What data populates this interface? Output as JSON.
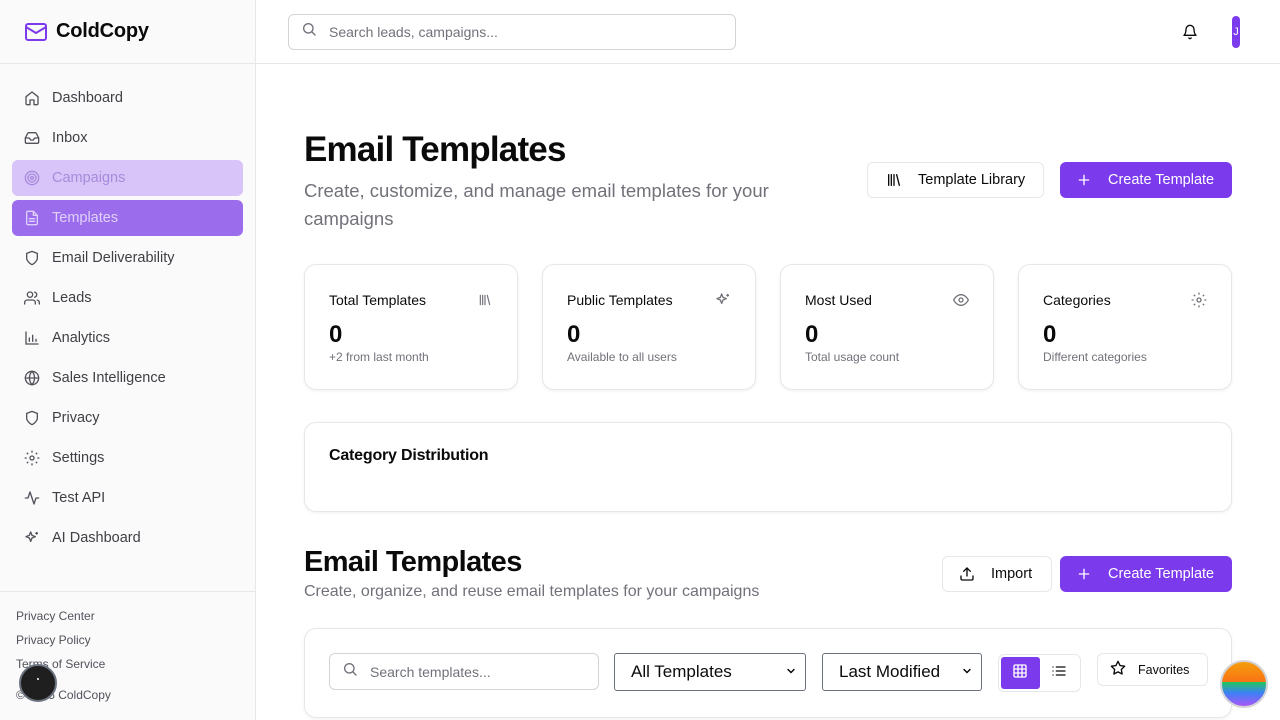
{
  "brand": {
    "name": "ColdCopy",
    "icon": "mail-icon",
    "accent": "#7c3aed"
  },
  "sidebar": {
    "items": [
      {
        "label": "Dashboard",
        "icon": "home-icon",
        "state": "normal"
      },
      {
        "label": "Inbox",
        "icon": "inbox-icon",
        "state": "normal"
      },
      {
        "label": "Campaigns",
        "icon": "target-icon",
        "state": "hover"
      },
      {
        "label": "Templates",
        "icon": "file-text-icon",
        "state": "active"
      },
      {
        "label": "Email Deliverability",
        "icon": "shield-icon",
        "state": "normal"
      },
      {
        "label": "Leads",
        "icon": "users-icon",
        "state": "normal"
      },
      {
        "label": "Analytics",
        "icon": "bar-chart-icon",
        "state": "normal"
      },
      {
        "label": "Sales Intelligence",
        "icon": "brain-icon",
        "state": "normal"
      },
      {
        "label": "Privacy",
        "icon": "shield-icon",
        "state": "normal"
      },
      {
        "label": "Settings",
        "icon": "gear-icon",
        "state": "normal"
      },
      {
        "label": "Test API",
        "icon": "activity-icon",
        "state": "normal"
      },
      {
        "label": "AI Dashboard",
        "icon": "sparkles-icon",
        "state": "normal"
      }
    ],
    "footer": {
      "links": [
        "Privacy Center",
        "Privacy Policy",
        "Terms of Service"
      ],
      "copyright": "© 2025 ColdCopy"
    }
  },
  "header": {
    "search_placeholder": "Search leads, campaigns...",
    "avatar_initial": "J"
  },
  "page": {
    "title": "Email Templates",
    "subtitle": "Create, customize, and manage email templates for your campaigns",
    "library_button": "Template Library",
    "create_button": "Create Template"
  },
  "stats": [
    {
      "title": "Total Templates",
      "value": "0",
      "sub": "+2 from last month",
      "icon": "library-icon"
    },
    {
      "title": "Public Templates",
      "value": "0",
      "sub": "Available to all users",
      "icon": "sparkles-icon"
    },
    {
      "title": "Most Used",
      "value": "0",
      "sub": "Total usage count",
      "icon": "eye-icon"
    },
    {
      "title": "Categories",
      "value": "0",
      "sub": "Different categories",
      "icon": "gear-icon"
    }
  ],
  "category_distribution": {
    "title": "Category Distribution"
  },
  "templates_section": {
    "title": "Email Templates",
    "subtitle": "Create, organize, and reuse email templates for your campaigns",
    "import_button": "Import",
    "create_button": "Create Template",
    "search_placeholder": "Search templates...",
    "filter_selected": "All Templates",
    "sort_selected": "Last Modified",
    "view_mode": "grid",
    "favorites_label": "Favorites"
  }
}
